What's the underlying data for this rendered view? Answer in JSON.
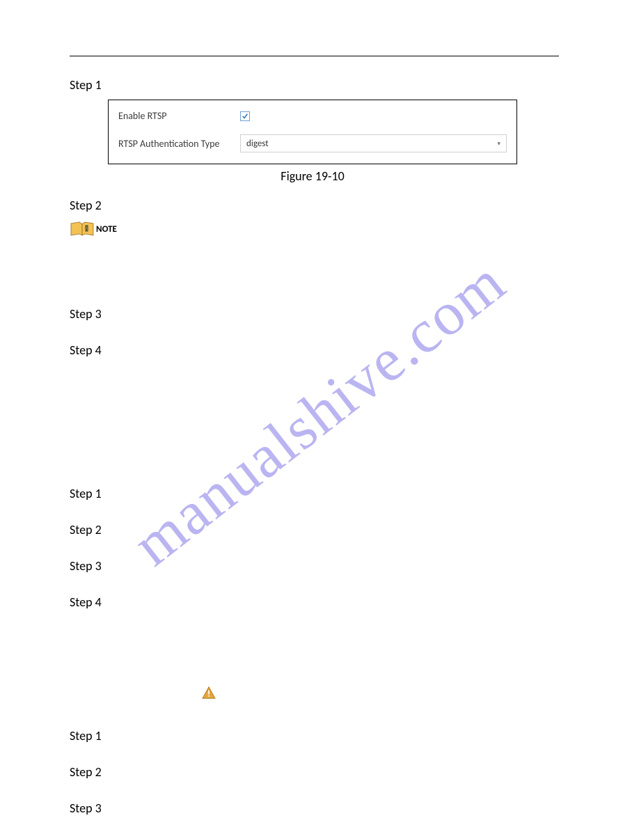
{
  "steps_section_a": {
    "s1": "Step 1",
    "s2": "Step 2",
    "s3": "Step 3",
    "s4": "Step 4"
  },
  "steps_section_b": {
    "s1": "Step 1",
    "s2": "Step 2",
    "s3": "Step 3",
    "s4": "Step 4"
  },
  "steps_section_c": {
    "s1": "Step 1",
    "s2": "Step 2",
    "s3": "Step 3"
  },
  "settings_box": {
    "enable_rtsp_label": "Enable RTSP",
    "enable_rtsp_checked": true,
    "auth_type_label": "RTSP Authentication Type",
    "auth_type_value": "digest"
  },
  "figure_caption": "Figure 19-10",
  "note_label": "NOTE",
  "watermark_text": "manualshive.com"
}
